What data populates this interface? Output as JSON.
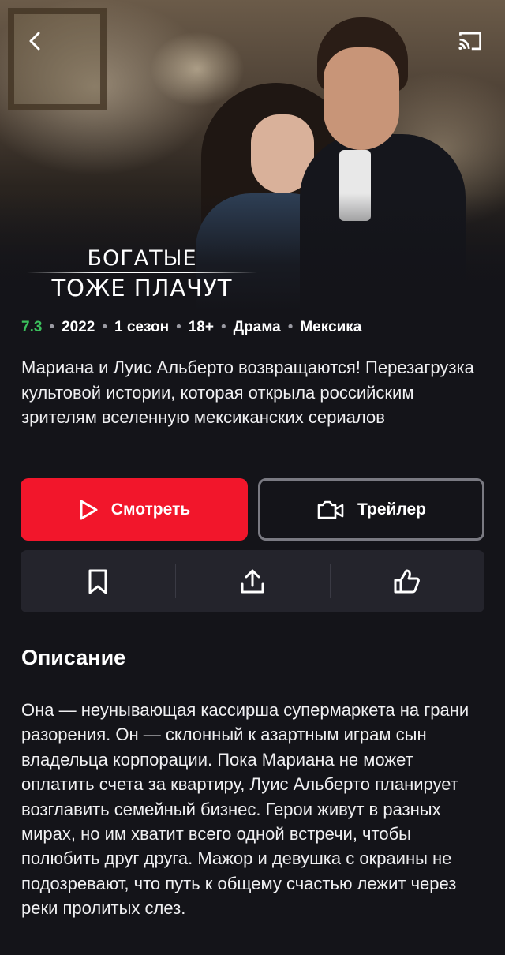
{
  "hero": {
    "logo_line1": "БОГАТЫЕ",
    "logo_line2": "ТОЖЕ ПЛАЧУТ"
  },
  "nav": {
    "back_icon": "chevron-left-icon",
    "cast_icon": "cast-icon"
  },
  "meta": {
    "rating": "7.3",
    "year": "2022",
    "seasons": "1 сезон",
    "age": "18+",
    "genre": "Драма",
    "country": "Мексика",
    "rating_color": "#3bbf5c"
  },
  "tagline": "Мариана и Луис Альберто возвращаются! Перезагрузка культовой истории, которая открыла российским зрителям вселенную мексиканских сериалов",
  "buttons": {
    "watch_label": "Смотреть",
    "trailer_label": "Трейлер",
    "watch_color": "#f2162b"
  },
  "actions": [
    {
      "icon": "bookmark-icon"
    },
    {
      "icon": "share-icon"
    },
    {
      "icon": "thumbs-up-icon"
    }
  ],
  "description": {
    "title": "Описание",
    "text": "Она — неунывающая кассирша супермаркета на грани разорения. Он — склонный к азартным играм сын владельца корпорации. Пока Мариана не может оплатить счета за квартиру, Луис Альберто планирует возглавить семейный бизнес. Герои живут в разных мирах, но им хватит всего одной встречи, чтобы полюбить друг друга. Мажор и девушка с окраины не подозревают, что путь к общему счастью лежит через реки пролитых слез."
  }
}
